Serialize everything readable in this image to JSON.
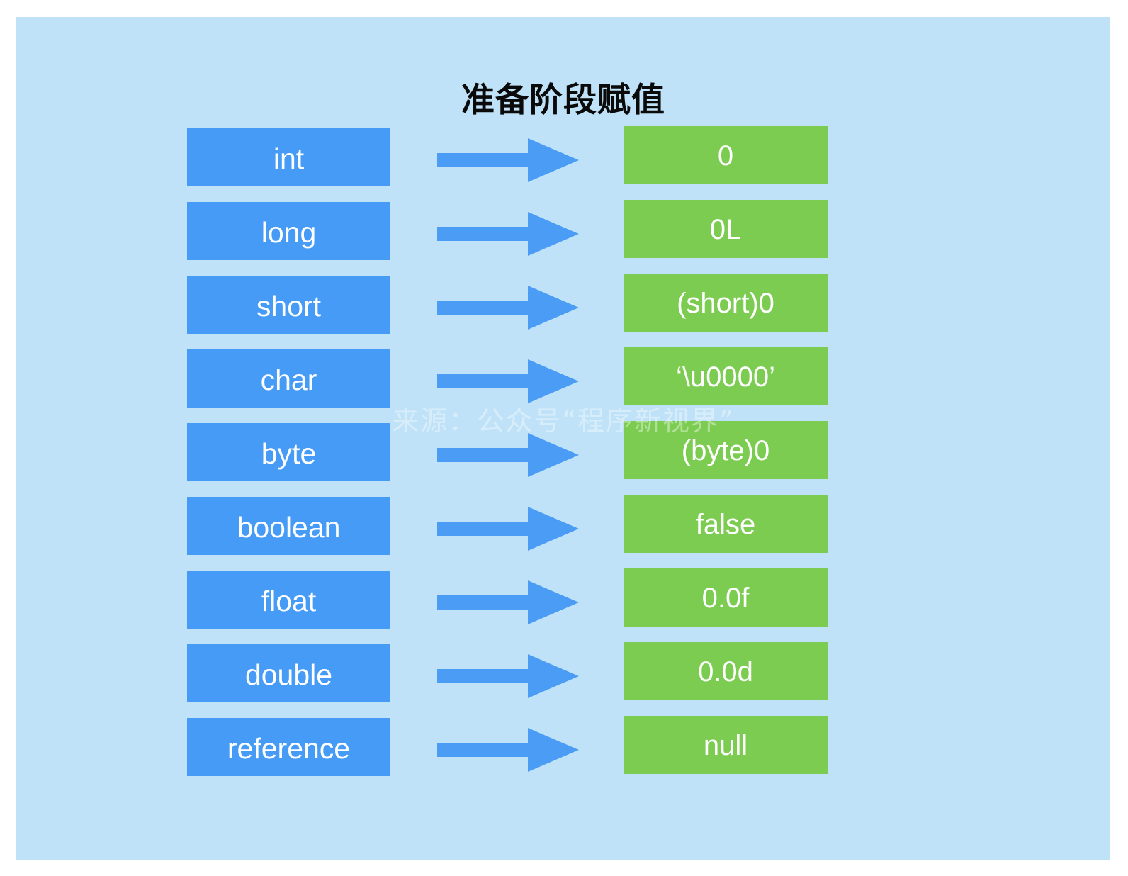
{
  "page": {
    "title": "准备阶段赋值",
    "background_color": "#ffffff",
    "panel_color": "#bfe2f8",
    "type_box_color": "#459bf5",
    "value_box_color": "#7dcc52",
    "arrow_color": "#4a9cf5",
    "label_color": "#ffffff",
    "title_color": "#0a0a0a"
  },
  "watermark": {
    "text": "来源：公众号“程序新视界”"
  },
  "arrow": {
    "name": "right-arrow-icon"
  },
  "rows": [
    {
      "type": "int",
      "value": "0"
    },
    {
      "type": "long",
      "value": "0L"
    },
    {
      "type": "short",
      "value": "(short)0"
    },
    {
      "type": "char",
      "value": "‘\\u0000’"
    },
    {
      "type": "byte",
      "value": "(byte)0"
    },
    {
      "type": "boolean",
      "value": "false"
    },
    {
      "type": "float",
      "value": "0.0f"
    },
    {
      "type": "double",
      "value": "0.0d"
    },
    {
      "type": "reference",
      "value": "null"
    }
  ]
}
